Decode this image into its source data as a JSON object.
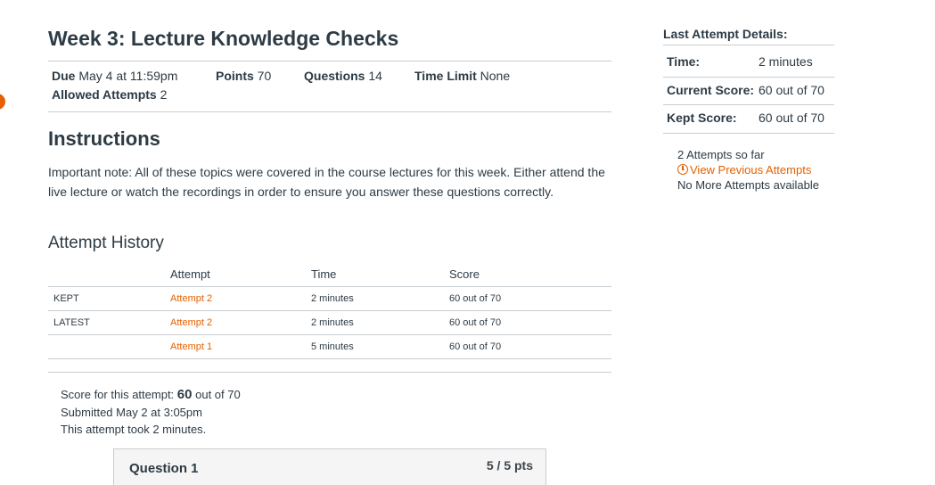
{
  "quiz": {
    "title": "Week 3: Lecture Knowledge Checks",
    "due_label": "Due",
    "due_value": "May 4 at 11:59pm",
    "points_label": "Points",
    "points_value": "70",
    "questions_label": "Questions",
    "questions_value": "14",
    "time_limit_label": "Time Limit",
    "time_limit_value": "None",
    "attempts_label": "Allowed Attempts",
    "attempts_value": "2"
  },
  "instructions": {
    "heading": "Instructions",
    "text": "Important note: All of these topics were covered in the course lectures for this week.  Either attend the live lecture or watch the recordings in order to ensure you answer these questions correctly."
  },
  "history": {
    "heading": "Attempt History",
    "columns": [
      "",
      "Attempt",
      "Time",
      "Score"
    ],
    "rows": [
      {
        "label": "KEPT",
        "attempt": "Attempt 2",
        "time": "2 minutes",
        "score": "60 out of 70"
      },
      {
        "label": "LATEST",
        "attempt": "Attempt 2",
        "time": "2 minutes",
        "score": "60 out of 70"
      },
      {
        "label": "",
        "attempt": "Attempt 1",
        "time": "5 minutes",
        "score": "60 out of 70"
      }
    ]
  },
  "attempt_summary": {
    "score_prefix": "Score for this attempt:",
    "score_value": "60",
    "score_suffix": "out of 70",
    "submitted": "Submitted May 2 at 3:05pm",
    "duration": "This attempt took 2 minutes."
  },
  "question": {
    "title": "Question 1",
    "points": "5 / 5 pts"
  },
  "last_attempt": {
    "heading": "Last Attempt Details:",
    "time_label": "Time:",
    "time_value": "2 minutes",
    "current_label": "Current Score:",
    "current_value": "60 out of 70",
    "kept_label": "Kept Score:",
    "kept_value": "60 out of 70",
    "attempts_so_far": "2 Attempts so far",
    "view_previous": "View Previous Attempts",
    "no_more": "No More Attempts available"
  },
  "colors": {
    "accent": "#e66000",
    "text": "#2d3b45",
    "rule": "#c7cdd1"
  }
}
